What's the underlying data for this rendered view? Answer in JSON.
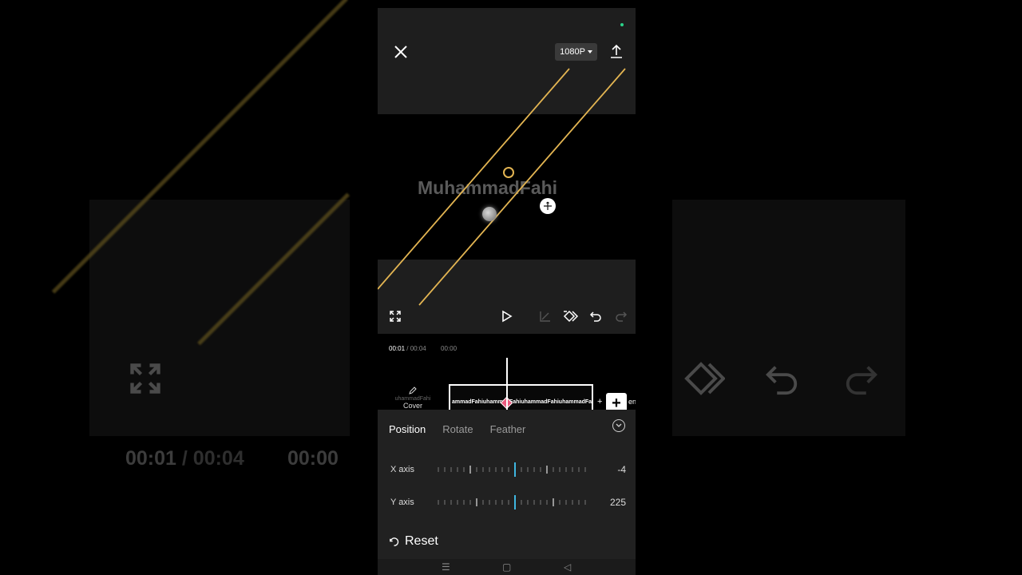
{
  "header": {
    "resolution_label": "1080P"
  },
  "preview": {
    "watermark_text": "MuhammadFahi"
  },
  "timeline": {
    "current_time": "00:01",
    "total_time": "/ 00:04",
    "marker_time": "00:00",
    "cover_label": "Cover",
    "cover_thumb_text": "uhammadFahi",
    "clip_text": "ammadFahiuhammadFahiuhammadFahiuhammadFahi",
    "end_text": "enc"
  },
  "panel": {
    "tabs": [
      {
        "label": "Position",
        "active": true
      },
      {
        "label": "Rotate",
        "active": false
      },
      {
        "label": "Feather",
        "active": false
      }
    ],
    "x_axis": {
      "label": "X axis",
      "value": "-4"
    },
    "y_axis": {
      "label": "Y axis",
      "value": "225"
    },
    "reset_label": "Reset"
  },
  "background": {
    "current_time": "00:01",
    "total_time": "/ 00:04",
    "marker_time": "00:00"
  },
  "colors": {
    "accent_gold": "#e3b552",
    "keyframe_pink": "#ea5a7e",
    "slider_blue": "#3fb6e0"
  },
  "icons": [
    "close-icon",
    "export-icon",
    "fullscreen-icon",
    "play-icon",
    "keyframe-curve-icon",
    "keyframe-icon",
    "undo-icon",
    "redo-icon",
    "collapse-icon",
    "reset-icon",
    "edit-icon"
  ]
}
